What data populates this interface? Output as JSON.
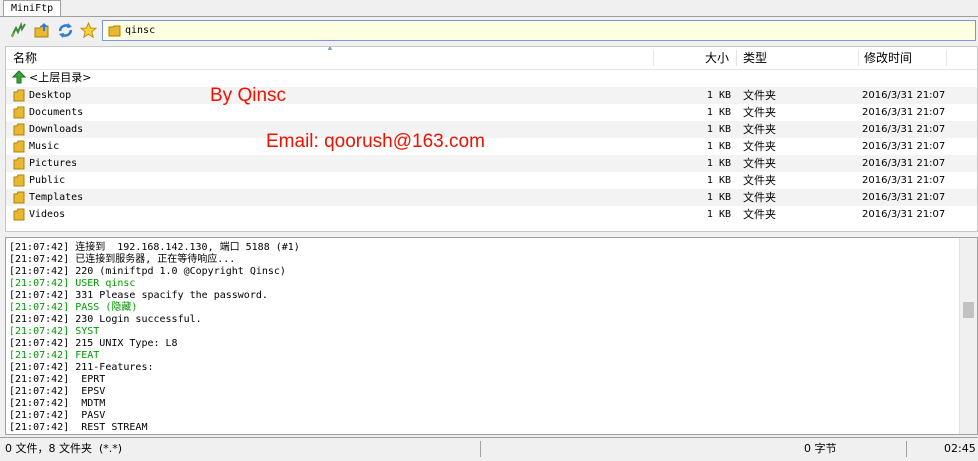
{
  "tab": {
    "label": "MiniFtp"
  },
  "path": {
    "value": "qinsc"
  },
  "columns": {
    "name": "名称",
    "size": "大小",
    "type": "类型",
    "modified": "修改时间"
  },
  "parent_dir": {
    "label": "<上层目录>"
  },
  "files": [
    {
      "name": "Desktop",
      "size": "1 KB",
      "type": "文件夹",
      "modified": "2016/3/31 21:07"
    },
    {
      "name": "Documents",
      "size": "1 KB",
      "type": "文件夹",
      "modified": "2016/3/31 21:07"
    },
    {
      "name": "Downloads",
      "size": "1 KB",
      "type": "文件夹",
      "modified": "2016/3/31 21:07"
    },
    {
      "name": "Music",
      "size": "1 KB",
      "type": "文件夹",
      "modified": "2016/3/31 21:07"
    },
    {
      "name": "Pictures",
      "size": "1 KB",
      "type": "文件夹",
      "modified": "2016/3/31 21:07"
    },
    {
      "name": "Public",
      "size": "1 KB",
      "type": "文件夹",
      "modified": "2016/3/31 21:07"
    },
    {
      "name": "Templates",
      "size": "1 KB",
      "type": "文件夹",
      "modified": "2016/3/31 21:07"
    },
    {
      "name": "Videos",
      "size": "1 KB",
      "type": "文件夹",
      "modified": "2016/3/31 21:07"
    }
  ],
  "watermark": {
    "author": "By  Qinsc",
    "email": "Email: qoorush@163.com"
  },
  "log": [
    {
      "text": "[21:07:42] 连接到  192.168.142.130, 端口 5188 (#1)",
      "kind": "resp"
    },
    {
      "text": "[21:07:42] 已连接到服务器, 正在等待响应...",
      "kind": "resp"
    },
    {
      "text": "[21:07:42] 220 (miniftpd 1.0 @Copyright Qinsc)",
      "kind": "resp"
    },
    {
      "text": "[21:07:42] USER qinsc",
      "kind": "cmd"
    },
    {
      "text": "[21:07:42] 331 Please spacify the password.",
      "kind": "resp"
    },
    {
      "text": "[21:07:42] PASS (隐藏)",
      "kind": "cmd"
    },
    {
      "text": "[21:07:42] 230 Login successful.",
      "kind": "resp"
    },
    {
      "text": "[21:07:42] SYST",
      "kind": "cmd"
    },
    {
      "text": "[21:07:42] 215 UNIX Type: L8",
      "kind": "resp"
    },
    {
      "text": "[21:07:42] FEAT",
      "kind": "cmd"
    },
    {
      "text": "[21:07:42] 211-Features:",
      "kind": "resp"
    },
    {
      "text": "[21:07:42]  EPRT",
      "kind": "resp"
    },
    {
      "text": "[21:07:42]  EPSV",
      "kind": "resp"
    },
    {
      "text": "[21:07:42]  MDTM",
      "kind": "resp"
    },
    {
      "text": "[21:07:42]  PASV",
      "kind": "resp"
    },
    {
      "text": "[21:07:42]  REST STREAM",
      "kind": "resp"
    }
  ],
  "status": {
    "counts": "0 文件，8 文件夹  (*.*)",
    "bytes": "0 字节",
    "time": "02:45"
  },
  "colors": {
    "log_command": "#009900",
    "watermark": "#ee1100",
    "folder": "#e8b830",
    "path_bg": "#ffffe1"
  },
  "icons": {
    "connect": "lightning-icon",
    "upload": "folder-upload-icon",
    "refresh": "refresh-icon",
    "favorite": "star-icon",
    "parent": "up-arrow-icon",
    "folder": "folder-icon"
  }
}
